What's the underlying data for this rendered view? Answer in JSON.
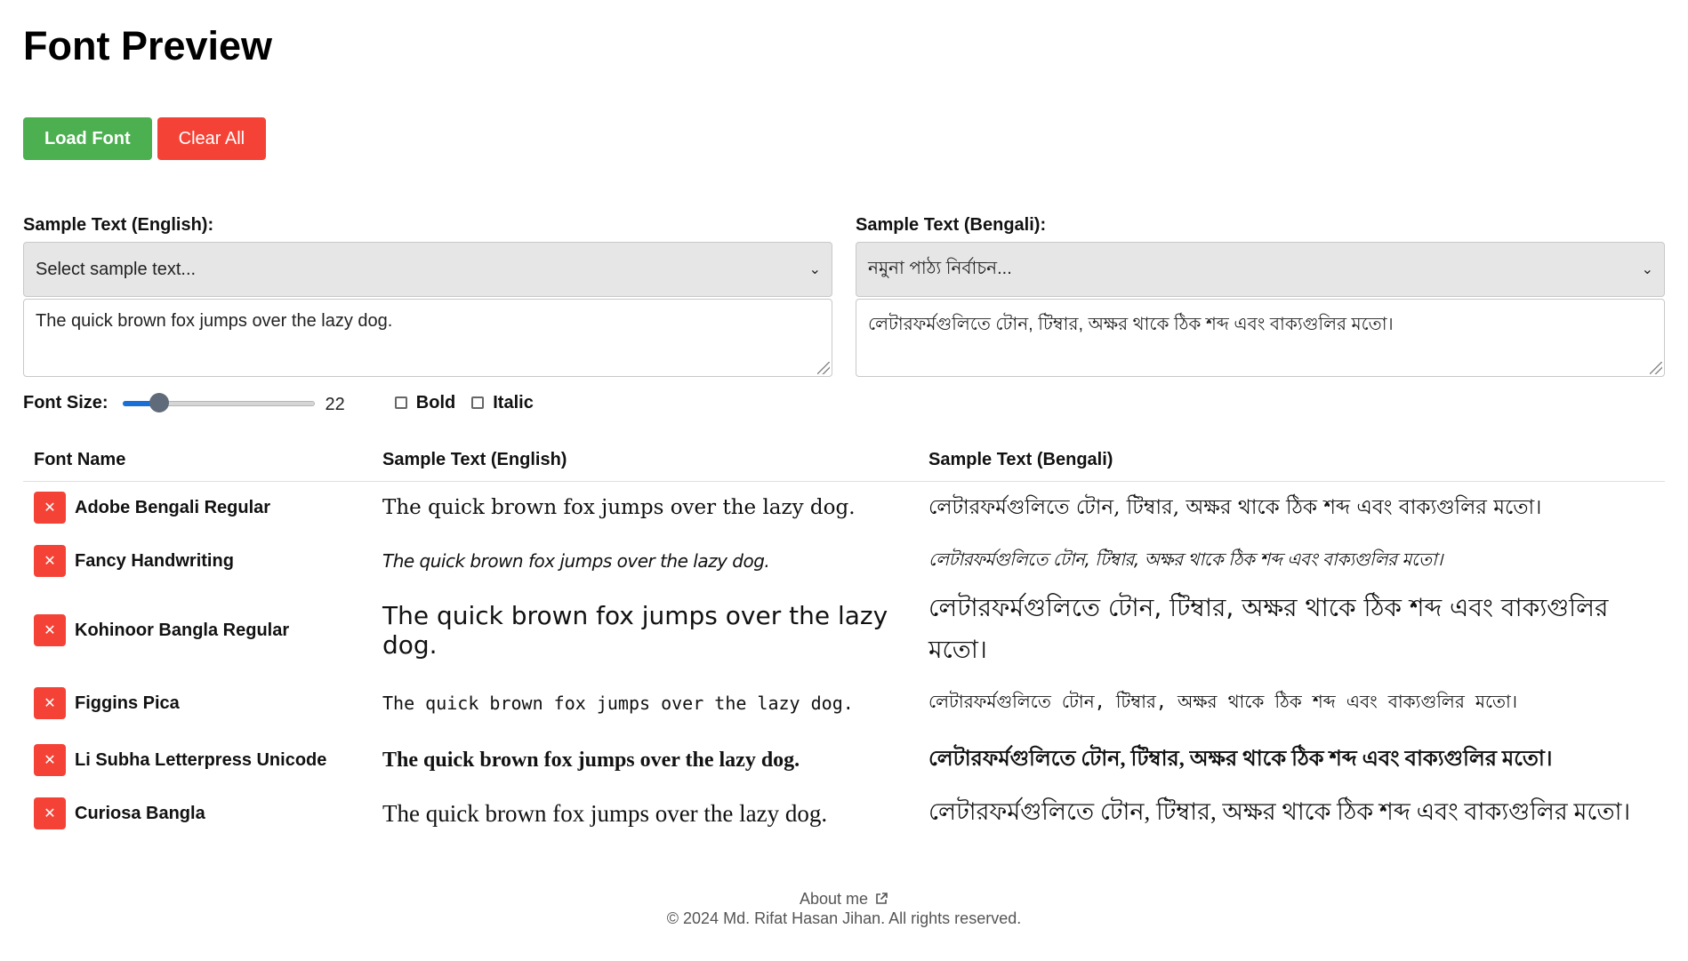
{
  "title": "Font Preview",
  "buttons": {
    "load_font": "Load Font",
    "clear_all": "Clear All"
  },
  "english": {
    "label": "Sample Text (English):",
    "select_value": "Select sample text...",
    "text": "The quick brown fox jumps over the lazy dog."
  },
  "bengali": {
    "label": "Sample Text (Bengali):",
    "select_value": "নমুনা পাঠ্য নির্বাচন...",
    "text": "লেটারফর্মগুলিতে টোন, টিম্বার, অক্ষর থাকে ঠিক শব্দ এবং বাক্যগুলির মতো।"
  },
  "controls": {
    "font_size_label": "Font Size:",
    "font_size_value": "22",
    "font_size_fraction": 0.19,
    "bold_label": "Bold",
    "italic_label": "Italic"
  },
  "table": {
    "headers": {
      "name": "Font Name",
      "english": "Sample Text (English)",
      "bengali": "Sample Text (Bengali)"
    },
    "rows": [
      {
        "name": "Adobe Bengali Regular",
        "english": "The quick brown fox jumps over the lazy dog.",
        "bengali": "লেটারফর্মগুলিতে টোন, টিম্বার, অক্ষর থাকে ঠিক শব্দ এবং বাক্যগুলির মতো।"
      },
      {
        "name": "Fancy Handwriting",
        "english": "The quick brown fox jumps over the lazy dog.",
        "bengali": "লেটারফর্মগুলিতে টোন, টিম্বার, অক্ষর থাকে ঠিক শব্দ এবং বাক্যগুলির মতো।"
      },
      {
        "name": "Kohinoor Bangla Regular",
        "english": "The quick brown fox jumps over the lazy dog.",
        "bengali": "লেটারফর্মগুলিতে টোন, টিম্বার, অক্ষর থাকে ঠিক শব্দ এবং বাক্যগুলির মতো।"
      },
      {
        "name": "Figgins Pica",
        "english": "The quick brown fox jumps over the lazy dog.",
        "bengali": "লেটারফর্মগুলিতে টোন, টিম্বার, অক্ষর থাকে ঠিক শব্দ এবং বাক্যগুলির মতো।"
      },
      {
        "name": "Li Subha Letterpress Unicode",
        "english": "The quick brown fox jumps over the lazy dog.",
        "bengali": "লেটারফর্মগুলিতে টোন, টিম্বার, অক্ষর থাকে ঠিক শব্দ এবং বাক্যগুলির মতো।"
      },
      {
        "name": "Curiosa Bangla",
        "english": "The quick brown fox jumps over the lazy dog.",
        "bengali": "লেটারফর্মগুলিতে টোন, টিম্বার, অক্ষর থাকে ঠিক শব্দ এবং বাক্যগুলির মতো।"
      }
    ]
  },
  "footer": {
    "about": "About me",
    "copyright": "© 2024 Md. Rifat Hasan Jihan. All rights reserved."
  },
  "colors": {
    "load_button": "#4caf50",
    "clear_button": "#f44336",
    "delete_button": "#f44336",
    "slider_fill": "#1a6fd6"
  },
  "icons": {
    "delete": "close-icon",
    "select_chevron": "chevron-down-icon",
    "external_link": "external-link-icon"
  }
}
